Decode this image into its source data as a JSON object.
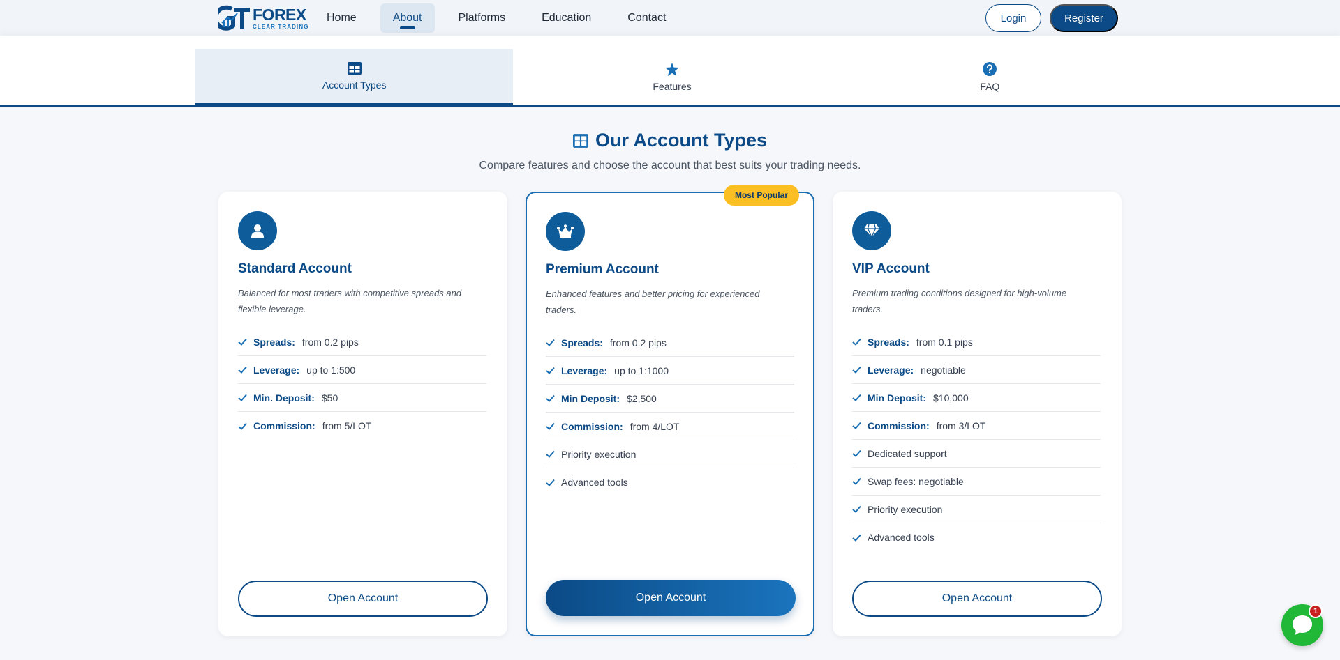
{
  "brand": {
    "logo_main": "FOREX",
    "logo_sub": "CLEAR TRADING",
    "accent": "#0b4a86"
  },
  "nav": {
    "items": [
      {
        "label": "Home"
      },
      {
        "label": "About"
      },
      {
        "label": "Platforms"
      },
      {
        "label": "Education"
      },
      {
        "label": "Contact"
      }
    ],
    "active": "About",
    "login": "Login",
    "register": "Register"
  },
  "tabs": [
    {
      "label": "Account Types",
      "icon": "table-icon"
    },
    {
      "label": "Features",
      "icon": "star-icon"
    },
    {
      "label": "FAQ",
      "icon": "question-circle-icon"
    }
  ],
  "section": {
    "title": "Our Account Types",
    "subtitle": "Compare features and choose the account that best suits your trading needs."
  },
  "cards": [
    {
      "icon": "user-icon",
      "title": "Standard Account",
      "description": "Balanced for most traders with competitive spreads and flexible leverage.",
      "features": [
        {
          "label": "Spreads:",
          "value": "from 0.2 pips"
        },
        {
          "label": "Leverage:",
          "value": "up to 1:500"
        },
        {
          "label": "Min. Deposit:",
          "value": "$50"
        },
        {
          "label": "Commission:",
          "value": "from 5/LOT"
        }
      ],
      "button": "Open Account"
    },
    {
      "icon": "crown-icon",
      "badge": "Most Popular",
      "title": "Premium Account",
      "description": "Enhanced features and better pricing for experienced traders.",
      "features": [
        {
          "label": "Spreads:",
          "value": "from 0.2 pips"
        },
        {
          "label": "Leverage:",
          "value": "up to 1:1000"
        },
        {
          "label": "Min Deposit:",
          "value": "$2,500"
        },
        {
          "label": "Commission:",
          "value": "from 4/LOT"
        },
        {
          "label": "",
          "value": "Priority execution"
        },
        {
          "label": "",
          "value": "Advanced tools"
        }
      ],
      "button": "Open Account"
    },
    {
      "icon": "diamond-icon",
      "title": "VIP Account",
      "description": "Premium trading conditions designed for high-volume traders.",
      "features": [
        {
          "label": "Spreads:",
          "value": "from 0.1 pips"
        },
        {
          "label": "Leverage:",
          "value": "negotiable"
        },
        {
          "label": "Min Deposit:",
          "value": "$10,000"
        },
        {
          "label": "Commission:",
          "value": "from 3/LOT"
        },
        {
          "label": "",
          "value": "Dedicated support"
        },
        {
          "label": "",
          "value": "Swap fees: negotiable"
        },
        {
          "label": "",
          "value": "Priority execution"
        },
        {
          "label": "",
          "value": "Advanced tools"
        }
      ],
      "button": "Open Account"
    }
  ],
  "chat": {
    "badge_count": "1",
    "icon": "chat-bubble-icon",
    "color": "#22b837"
  }
}
